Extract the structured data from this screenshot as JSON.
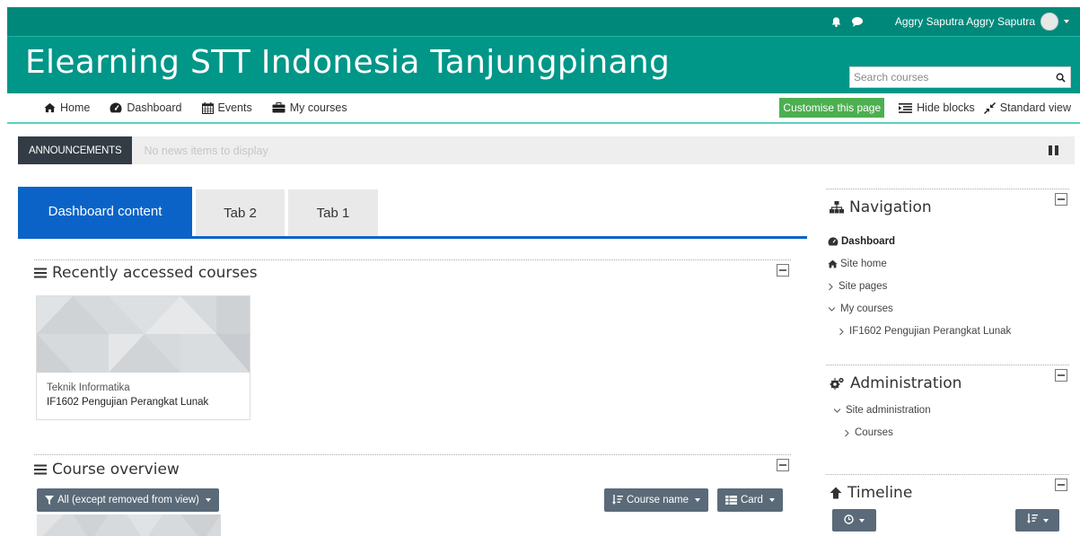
{
  "topbar": {
    "user_name": "Aggry Saputra Aggry Saputra",
    "icons": [
      "bell-icon",
      "chat-bubble-icon"
    ]
  },
  "header": {
    "site_title": "Elearning STT Indonesia Tanjungpinang",
    "search_placeholder": "Search courses"
  },
  "nav": {
    "items": [
      {
        "label": "Home",
        "icon": "home-icon"
      },
      {
        "label": "Dashboard",
        "icon": "dashboard-icon"
      },
      {
        "label": "Events",
        "icon": "calendar-icon"
      },
      {
        "label": "My courses",
        "icon": "briefcase-icon"
      }
    ],
    "customise_label": "Customise this page",
    "hide_blocks_label": "Hide blocks",
    "standard_view_label": "Standard view"
  },
  "announcements": {
    "label": "ANNOUNCEMENTS",
    "text": "No news items to display"
  },
  "tabs": [
    {
      "label": "Dashboard content",
      "active": true
    },
    {
      "label": "Tab 2",
      "active": false
    },
    {
      "label": "Tab 1",
      "active": false
    }
  ],
  "recent": {
    "title": "Recently accessed courses",
    "course": {
      "category": "Teknik Informatika",
      "name": "IF1602 Pengujian Perangkat Lunak"
    }
  },
  "overview": {
    "title": "Course overview",
    "filter_label": "All (except removed from view)",
    "sort_label": "Course name",
    "view_label": "Card"
  },
  "navigation": {
    "title": "Navigation",
    "dashboard": "Dashboard",
    "site_home": "Site home",
    "site_pages": "Site pages",
    "my_courses": "My courses",
    "course": "IF1602 Pengujian Perangkat Lunak"
  },
  "administration": {
    "title": "Administration",
    "site_admin": "Site administration",
    "courses": "Courses"
  },
  "timeline": {
    "title": "Timeline"
  },
  "colors": {
    "brand": "#009688",
    "topbar": "#00897b",
    "tab_active": "#0b63c8",
    "button_green": "#4caf50",
    "dropdown": "#5a6a78"
  }
}
